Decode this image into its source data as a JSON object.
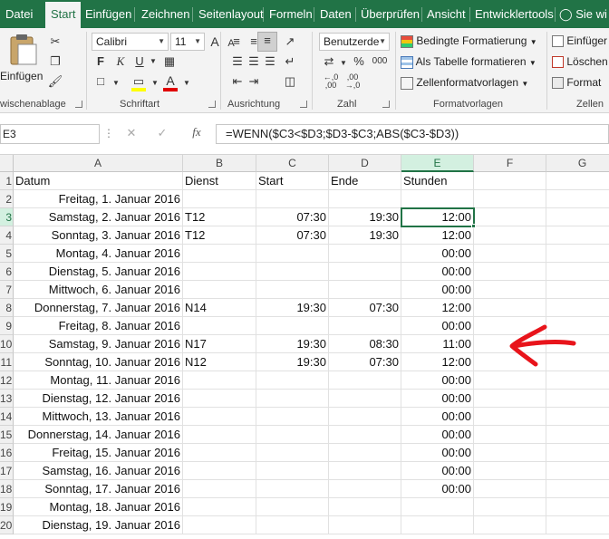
{
  "tabs": [
    "Datei",
    "Start",
    "Einfügen",
    "Zeichnen",
    "Seitenlayout",
    "Formeln",
    "Daten",
    "Überprüfen",
    "Ansicht",
    "Entwicklertools",
    "Sie wi"
  ],
  "ribbon": {
    "clipboard": {
      "paste_label": "Einfügen",
      "group_label": "wischenablage"
    },
    "font": {
      "font_name": "Calibri",
      "font_size": "11",
      "bold": "F",
      "italic": "K",
      "underline": "U",
      "grow": "A",
      "shrink": "A",
      "group_label": "Schriftart"
    },
    "alignment": {
      "group_label": "Ausrichtung"
    },
    "number": {
      "format": "Benutzerde",
      "percent": "%",
      "thousands": "000",
      "group_label": "Zahl"
    },
    "styles": {
      "conditional": "Bedingte Formatierung",
      "as_table": "Als Tabelle formatieren",
      "cell_styles": "Zellenformatvorlagen",
      "group_label": "Formatvorlagen"
    },
    "cells": {
      "insert": "Einfüger",
      "delete": "Löschen",
      "format": "Format",
      "group_label": "Zellen"
    }
  },
  "formula_bar": {
    "name_box": "E3",
    "fx": "fx",
    "formula": "=WENN($C3<$D3;$D3-$C3;ABS($C3-$D3))"
  },
  "columns": [
    "A",
    "B",
    "C",
    "D",
    "E",
    "F",
    "G"
  ],
  "selected_cell": "E3",
  "colors": {
    "accent": "#217346",
    "annotation": "#e8141b"
  },
  "rows": [
    {
      "n": "1",
      "a": "Datum",
      "b": "Dienst",
      "c": "Start",
      "d": "Ende",
      "e": "Stunden"
    },
    {
      "n": "2",
      "a": "Freitag, 1. Januar 2016",
      "b": "",
      "c": "",
      "d": "",
      "e": ""
    },
    {
      "n": "3",
      "a": "Samstag, 2. Januar 2016",
      "b": "T12",
      "c": "07:30",
      "d": "19:30",
      "e": "12:00"
    },
    {
      "n": "4",
      "a": "Sonntag, 3. Januar 2016",
      "b": "T12",
      "c": "07:30",
      "d": "19:30",
      "e": "12:00"
    },
    {
      "n": "5",
      "a": "Montag, 4. Januar 2016",
      "b": "",
      "c": "",
      "d": "",
      "e": "00:00"
    },
    {
      "n": "6",
      "a": "Dienstag, 5. Januar 2016",
      "b": "",
      "c": "",
      "d": "",
      "e": "00:00"
    },
    {
      "n": "7",
      "a": "Mittwoch, 6. Januar 2016",
      "b": "",
      "c": "",
      "d": "",
      "e": "00:00"
    },
    {
      "n": "8",
      "a": "Donnerstag, 7. Januar 2016",
      "b": "N14",
      "c": "19:30",
      "d": "07:30",
      "e": "12:00"
    },
    {
      "n": "9",
      "a": "Freitag, 8. Januar 2016",
      "b": "",
      "c": "",
      "d": "",
      "e": "00:00"
    },
    {
      "n": "10",
      "a": "Samstag, 9. Januar 2016",
      "b": "N17",
      "c": "19:30",
      "d": "08:30",
      "e": "11:00"
    },
    {
      "n": "11",
      "a": "Sonntag, 10. Januar 2016",
      "b": "N12",
      "c": "19:30",
      "d": "07:30",
      "e": "12:00"
    },
    {
      "n": "12",
      "a": "Montag, 11. Januar 2016",
      "b": "",
      "c": "",
      "d": "",
      "e": "00:00"
    },
    {
      "n": "13",
      "a": "Dienstag, 12. Januar 2016",
      "b": "",
      "c": "",
      "d": "",
      "e": "00:00"
    },
    {
      "n": "14",
      "a": "Mittwoch, 13. Januar 2016",
      "b": "",
      "c": "",
      "d": "",
      "e": "00:00"
    },
    {
      "n": "15",
      "a": "Donnerstag, 14. Januar 2016",
      "b": "",
      "c": "",
      "d": "",
      "e": "00:00"
    },
    {
      "n": "16",
      "a": "Freitag, 15. Januar 2016",
      "b": "",
      "c": "",
      "d": "",
      "e": "00:00"
    },
    {
      "n": "17",
      "a": "Samstag, 16. Januar 2016",
      "b": "",
      "c": "",
      "d": "",
      "e": "00:00"
    },
    {
      "n": "18",
      "a": "Sonntag, 17. Januar 2016",
      "b": "",
      "c": "",
      "d": "",
      "e": "00:00"
    },
    {
      "n": "19",
      "a": "Montag, 18. Januar 2016",
      "b": "",
      "c": "",
      "d": "",
      "e": ""
    },
    {
      "n": "20",
      "a": "Dienstag, 19. Januar 2016",
      "b": "",
      "c": "",
      "d": "",
      "e": ""
    }
  ]
}
